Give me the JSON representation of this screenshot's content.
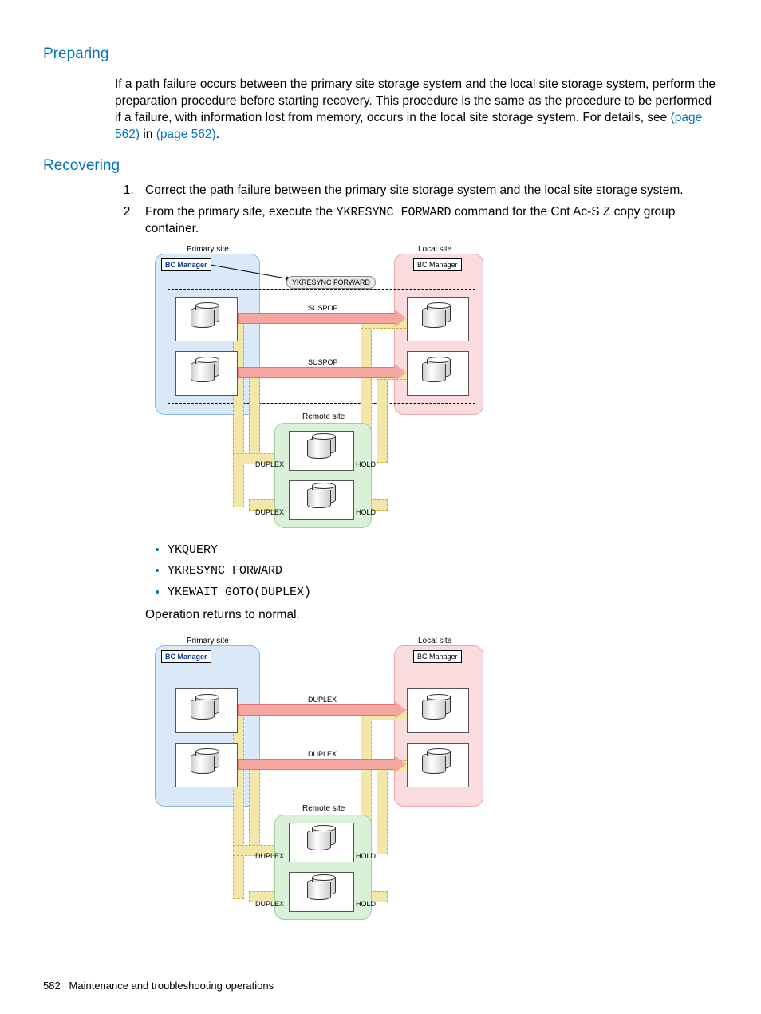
{
  "headings": {
    "preparing": "Preparing",
    "recovering": "Recovering"
  },
  "para_preparing_pre": "If a path failure occurs between the primary site storage system and the local site storage system, perform the preparation procedure before starting recovery. This procedure is the same as the procedure to be performed if a failure, with information lost from memory, occurs in the local site storage system. For details, see ",
  "link1": "(page 562)",
  "para_preparing_mid": " in ",
  "link2": "(page 562)",
  "para_preparing_post": ".",
  "steps": [
    "Correct the path failure between the primary site storage system and the local site storage system.",
    {
      "pre": "From the primary site, execute the ",
      "cmd": "YKRESYNC FORWARD",
      "post": " command for the Cnt Ac-S Z copy group container."
    }
  ],
  "commands": [
    "YKQUERY",
    "YKRESYNC FORWARD",
    "YKEWAIT GOTO(DUPLEX)"
  ],
  "optext": "Operation returns to normal.",
  "diagram": {
    "primary_site": "Primary site",
    "local_site": "Local site",
    "remote_site": "Remote site",
    "bcm": "BC Manager",
    "cmd": "YKRESYNC FORWARD",
    "suspop": "SUSPOP",
    "duplex": "DUPLEX",
    "hold": "HOLD"
  },
  "footer": {
    "page": "582",
    "title": "Maintenance and troubleshooting operations"
  }
}
